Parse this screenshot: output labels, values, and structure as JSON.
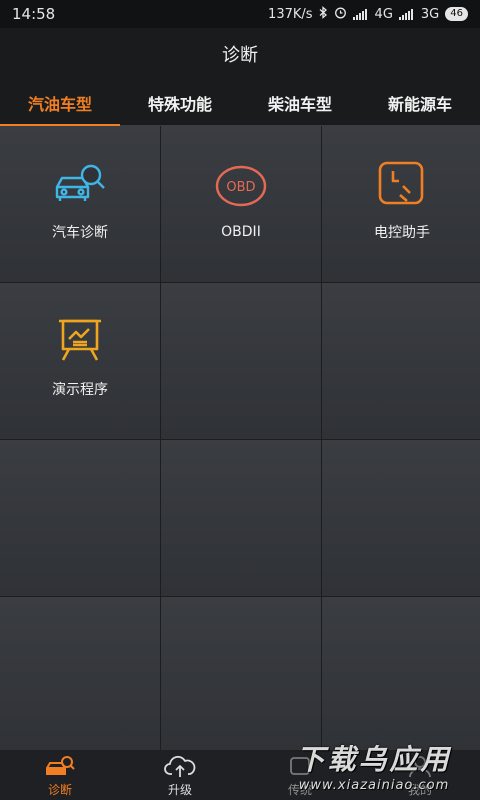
{
  "status_bar": {
    "time": "14:58",
    "speed": "137K/s",
    "network_1": "4G",
    "network_2": "3G",
    "battery": "46"
  },
  "header": {
    "title": "诊断"
  },
  "tabs": [
    {
      "label": "汽油车型",
      "active": true
    },
    {
      "label": "特殊功能",
      "active": false
    },
    {
      "label": "柴油车型",
      "active": false
    },
    {
      "label": "新能源车",
      "active": false
    }
  ],
  "grid_items": [
    {
      "label": "汽车诊断",
      "icon": "car-diagnosis-icon",
      "color": "#3fb6e6"
    },
    {
      "label": "OBDII",
      "icon": "obd-icon",
      "color": "#e46a55"
    },
    {
      "label": "电控助手",
      "icon": "ecu-assistant-icon",
      "color": "#f07f24"
    },
    {
      "label": "演示程序",
      "icon": "demo-program-icon",
      "color": "#f0a51f"
    }
  ],
  "bottom_nav": [
    {
      "label": "诊断",
      "icon": "diagnosis-icon",
      "active": true
    },
    {
      "label": "升级",
      "icon": "cloud-upgrade-icon",
      "active": false
    },
    {
      "label": "传统",
      "icon": "traditional-icon",
      "active": false
    },
    {
      "label": "我的",
      "icon": "profile-icon",
      "active": false
    }
  ],
  "watermark": {
    "title": "下载乌应用",
    "url": "www.xiazainiao.com"
  },
  "colors": {
    "accent": "#f07f24",
    "background": "#2b2d30",
    "header": "#1a1b1d"
  }
}
